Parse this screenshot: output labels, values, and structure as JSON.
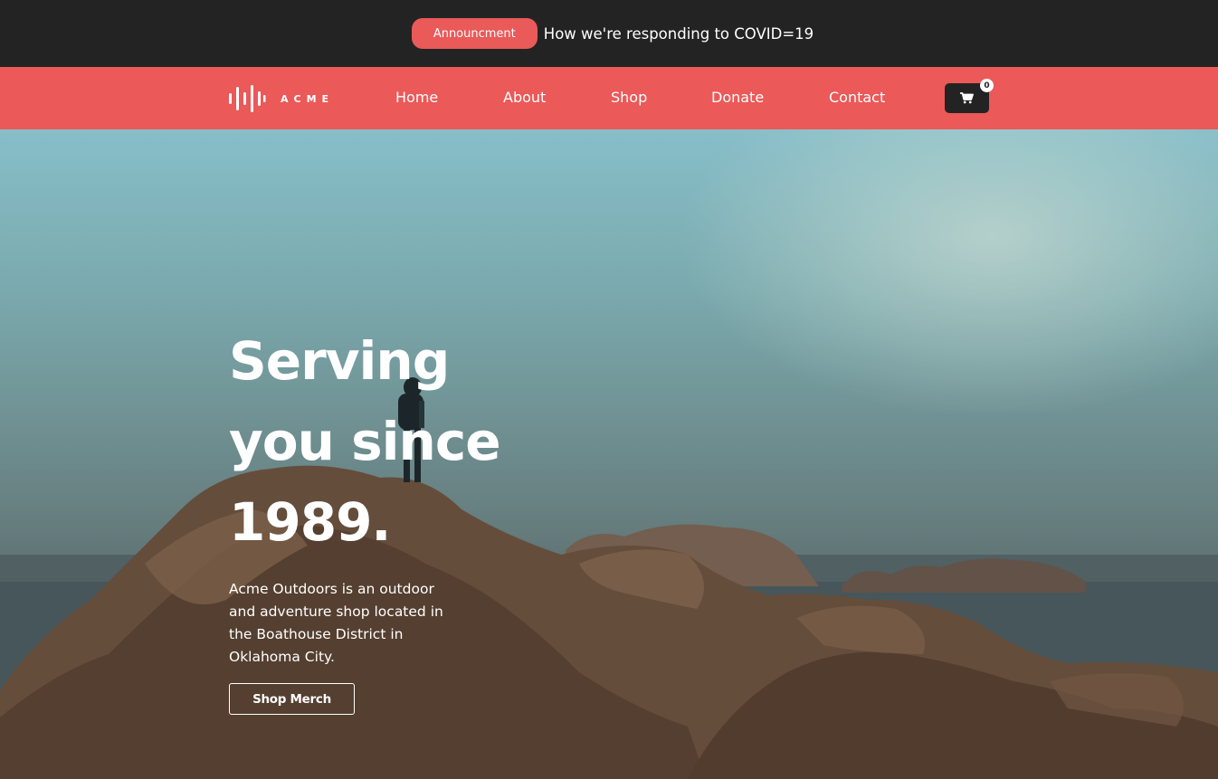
{
  "announcement": {
    "pill_label": "Announcment",
    "text": "How we're responding to COVID=19"
  },
  "nav": {
    "logo_text": "ACME",
    "links": [
      "Home",
      "About",
      "Shop",
      "Donate",
      "Contact"
    ],
    "cart_count": "0"
  },
  "hero": {
    "title_line1": "Serving",
    "title_line2": "you since",
    "title_line3": "1989.",
    "description": "Acme Outdoors is an outdoor and adventure shop located in the Boathouse District in Oklahoma City.",
    "cta_label": "Shop Merch"
  },
  "colors": {
    "accent": "#eb5958",
    "dark": "#232323",
    "text": "#ffffff"
  },
  "icons": {
    "logo": "sound-wave-logo-icon",
    "cart": "shopping-cart-icon"
  }
}
